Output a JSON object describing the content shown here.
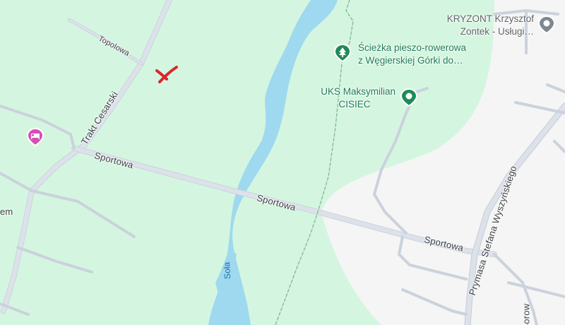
{
  "colors": {
    "park": "#d4f6e0",
    "urban": "#f5f5f5",
    "water": "#9fd9ef",
    "road": "#d6dbe3",
    "road_edge": "#c5ccd6",
    "poi_green": "#1e7b55",
    "poi_gray": "#5f6368",
    "hotel_pin": "#d64fb3",
    "marker": "#d9272e"
  },
  "roads": {
    "topolowa": "Topolowa",
    "trakt_cesarski": "Trakt Cesarski",
    "sportowa_1": "Sportowa",
    "sportowa_2": "Sportowa",
    "sportowa_3": "Sportowa",
    "prymasa": "Prymasa Stefana Wyszyńskiego",
    "borow": "Borow",
    "left_fragment": "em"
  },
  "water": {
    "river": "Soła"
  },
  "pois": {
    "path": {
      "line1": "Ścieżka pieszo-rowerowa",
      "line2": "z Węgierskiej Górki do…",
      "icon": "tree-icon"
    },
    "uks": {
      "line1": "UKS Maksymilian",
      "line2": "CISIEC",
      "icon": "place-dot-icon"
    },
    "kryzont": {
      "line1": "KRYZONT Krzysztof",
      "line2": "Zontek - Usługi…",
      "icon": "business-pin-icon"
    },
    "hotel": {
      "icon": "hotel-bed-icon"
    }
  },
  "marker": {
    "icon": "x-mark-icon"
  }
}
